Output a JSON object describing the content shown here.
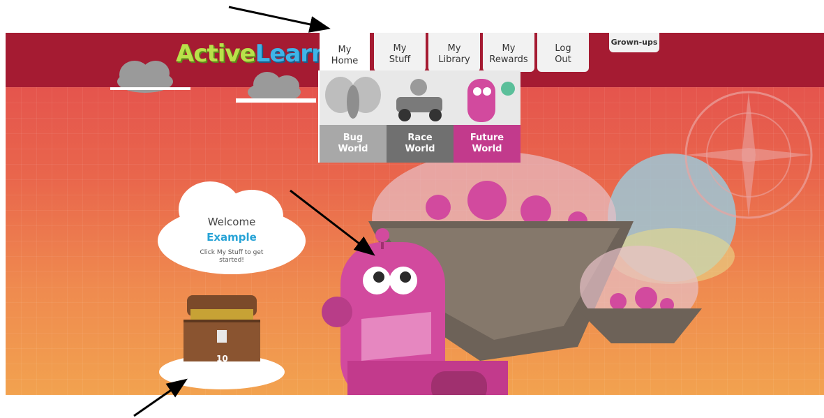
{
  "logo": {
    "part1": "Active",
    "part2": "Learn"
  },
  "nav": [
    {
      "label": "My\nHome",
      "active": true
    },
    {
      "label": "My\nStuff"
    },
    {
      "label": "My\nLibrary"
    },
    {
      "label": "My\nRewards"
    },
    {
      "label": "Log\nOut"
    }
  ],
  "grownups": "Grown-ups",
  "worlds": [
    {
      "label": "Bug\nWorld",
      "color": "#a8a8a8"
    },
    {
      "label": "Race\nWorld",
      "color": "#707070"
    },
    {
      "label": "Future\nWorld",
      "color": "#c23a8c"
    }
  ],
  "welcome": {
    "title": "Welcome",
    "name": "Example",
    "hint": "Click My Stuff to get started!"
  },
  "chest": {
    "count": "10"
  },
  "colors": {
    "topbar": "#a51b32",
    "robot": "#d24a9e",
    "accent_blue": "#27a3d6"
  }
}
